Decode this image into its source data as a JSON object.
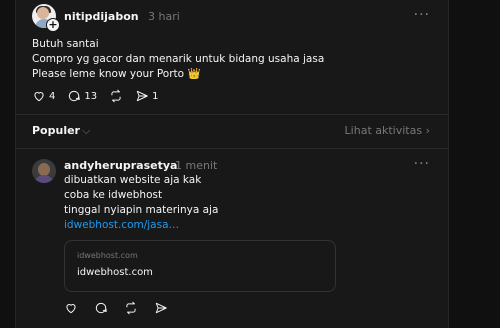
{
  "post1": {
    "username": "nitipdijabon",
    "time": "3 hari",
    "lines": [
      "Butuh santai",
      "Compro yg gacor dan menarik untuk bidang usaha jasa",
      "Please leme know your Porto"
    ],
    "crown_emoji": "👑",
    "likes": "4",
    "comments": "13",
    "shares": "1",
    "more": "···"
  },
  "section": {
    "label": "Populer",
    "chevron": "⌵",
    "link": "Lihat aktivitas",
    "link_chevron": "›"
  },
  "post2": {
    "username": "andyheruprasetya",
    "time": "1 menit",
    "lines": [
      "dibuatkan website aja kak",
      "coba ke idwebhost",
      "tinggal nyiapin materinya aja"
    ],
    "link_text": "idwebhost.com/jasa…",
    "more": "···",
    "preview": {
      "domain": "idwebhost.com",
      "title": "idwebhost.com"
    }
  },
  "icons": {
    "plus": "+",
    "like": "heart-icon",
    "comment": "comment-icon",
    "repost": "repost-icon",
    "share": "share-icon"
  }
}
